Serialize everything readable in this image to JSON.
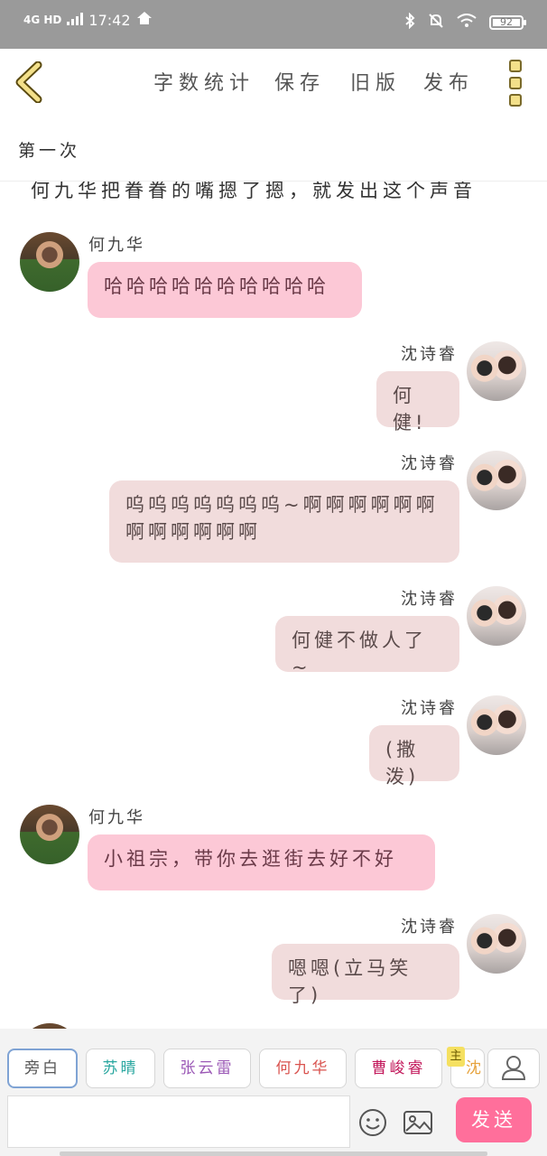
{
  "status_bar": {
    "network": "4G HD",
    "time": "17:42",
    "battery": "92"
  },
  "toolbar": {
    "items": [
      "字数统计",
      "保存",
      "旧版",
      "发布"
    ]
  },
  "chapter": {
    "title": "第一次"
  },
  "chat": {
    "narration_partial": "何九华把眷眷的嘴摁了摁，就发出这个声音",
    "messages": [
      {
        "side": "left",
        "name": "何九华",
        "text": "哈哈哈哈哈哈哈哈哈哈"
      },
      {
        "side": "right",
        "name": "沈诗睿",
        "text": "何健!"
      },
      {
        "side": "right",
        "name": "沈诗睿",
        "text": "呜呜呜呜呜呜呜~啊啊啊啊啊啊啊啊啊啊啊啊"
      },
      {
        "side": "right",
        "name": "沈诗睿",
        "text": "何健不做人了~"
      },
      {
        "side": "right",
        "name": "沈诗睿",
        "text": "(撒泼)"
      },
      {
        "side": "left",
        "name": "何九华",
        "text": "小祖宗，带你去逛街去好不好"
      },
      {
        "side": "right",
        "name": "沈诗睿",
        "text": "嗯嗯(立马笑了)"
      }
    ]
  },
  "characters": {
    "chips": [
      {
        "label": "旁白",
        "color": "#555555"
      },
      {
        "label": "苏晴",
        "color": "#2aa7a0"
      },
      {
        "label": "张云雷",
        "color": "#9b59b6"
      },
      {
        "label": "何九华",
        "color": "#d9534f"
      },
      {
        "label": "曹峻睿",
        "color": "#c2185b"
      },
      {
        "label": "沈",
        "color": "#e6a23c"
      }
    ],
    "badge": "主"
  },
  "composer": {
    "send_label": "发送"
  }
}
